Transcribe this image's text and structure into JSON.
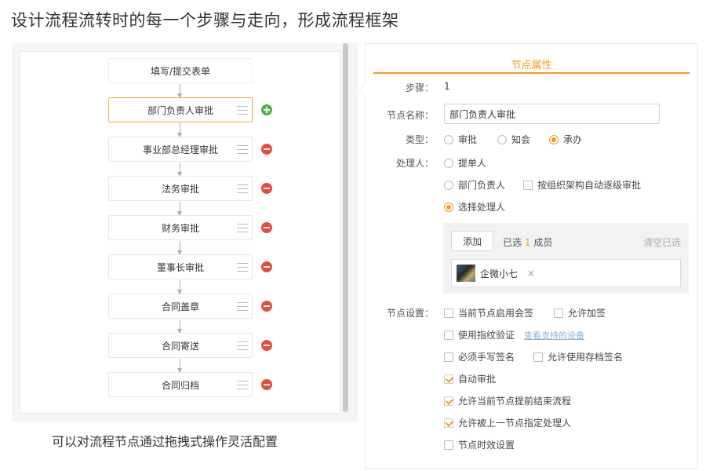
{
  "headline": "设计流程流转时的每一个步骤与走向，形成流程框架",
  "flow": {
    "nodes": [
      {
        "label": "填写/提交表单"
      },
      {
        "label": "部门负责人审批"
      },
      {
        "label": "事业部总经理审批"
      },
      {
        "label": "法务审批"
      },
      {
        "label": "财务审批"
      },
      {
        "label": "董事长审批"
      },
      {
        "label": "合同盖章"
      },
      {
        "label": "合同寄送"
      },
      {
        "label": "合同归档"
      }
    ],
    "caption": "可以对流程节点通过拖拽式操作灵活配置"
  },
  "props": {
    "title": "节点属性",
    "step_label": "步骤：",
    "step_value": "1",
    "name_label": "节点名称：",
    "name_value": "部门负责人审批",
    "type_label": "类型：",
    "type_options": [
      "审批",
      "知会",
      "承办"
    ],
    "type_selected": "承办",
    "handler_label": "处理人：",
    "handler_options": [
      "提单人",
      "部门负责人",
      "选择处理人"
    ],
    "handler_selected": "选择处理人",
    "handler_org_check": "按组织架构自动逐级审批",
    "add_button": "添加",
    "selected_prefix": "已选",
    "selected_count": "1",
    "selected_suffix": "成员",
    "clear_label": "清空已选",
    "member_name": "企微小七",
    "member_remove": "×",
    "settings_label": "节点设置：",
    "settings": [
      {
        "label": "当前节点启用会签",
        "checked": false
      },
      {
        "label": "允许加签",
        "checked": false
      },
      {
        "label": "使用指纹验证",
        "checked": false
      },
      {
        "label": "查看支持的设备",
        "checked": false
      },
      {
        "label": "必须手写签名",
        "checked": false
      },
      {
        "label": "允许使用存档签名",
        "checked": false
      },
      {
        "label": "自动审批",
        "checked": true
      },
      {
        "label": "允许当前节点提前结束流程",
        "checked": true
      },
      {
        "label": "允许被上一节点指定处理人",
        "checked": true
      },
      {
        "label": "节点时效设置",
        "checked": false
      }
    ]
  },
  "colors": {
    "accent": "#f39a1e",
    "add": "#4cae4c",
    "delete": "#e84d3c"
  }
}
